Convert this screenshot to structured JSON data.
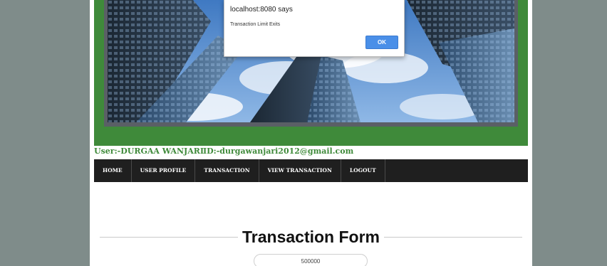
{
  "user": {
    "name_label": "User:-DURGAA WANJARI",
    "id_label": "ID:-durgawanjari2012@gmail.com"
  },
  "nav": {
    "items": [
      {
        "label": "HOME"
      },
      {
        "label": "USER PROFILE"
      },
      {
        "label": "TRANSACTION"
      },
      {
        "label": "VIEW TRANSACTION"
      },
      {
        "label": "LOGOUT"
      }
    ]
  },
  "form": {
    "title": "Transaction Form",
    "amount_value": "500000"
  },
  "dialog": {
    "title": "localhost:8080 says",
    "message": "Transaction Limit Exits",
    "ok_label": "OK"
  },
  "colors": {
    "page_bg": "#7f8c8a",
    "brand_green": "#3f8a3a",
    "nav_bg": "#1f1f1f",
    "ok_button": "#4a8fe8"
  },
  "icons": {
    "banner": "skyscrapers-photo"
  }
}
